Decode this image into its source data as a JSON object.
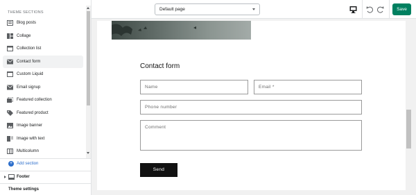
{
  "topbar": {
    "page_selector": "Default page",
    "save_label": "Save"
  },
  "sidebar": {
    "heading": "THEME SECTIONS",
    "items": [
      {
        "label": "Blog posts",
        "icon": "blog-icon"
      },
      {
        "label": "Collage",
        "icon": "collage-icon"
      },
      {
        "label": "Collection list",
        "icon": "collection-list-icon"
      },
      {
        "label": "Contact form",
        "icon": "envelope-icon",
        "active": true
      },
      {
        "label": "Custom Liquid",
        "icon": "code-icon"
      },
      {
        "label": "Email signup",
        "icon": "envelope-icon"
      },
      {
        "label": "Featured collection",
        "icon": "collection-icon"
      },
      {
        "label": "Featured product",
        "icon": "tag-icon"
      },
      {
        "label": "Image banner",
        "icon": "image-icon"
      },
      {
        "label": "Image with text",
        "icon": "image-text-icon"
      },
      {
        "label": "Multicolumn",
        "icon": "columns-icon"
      }
    ],
    "add_section": "Add section",
    "footer": "Footer",
    "theme_settings": "Theme settings"
  },
  "preview": {
    "form_title": "Contact form",
    "name_placeholder": "Name",
    "email_placeholder": "Email *",
    "phone_placeholder": "Phone number",
    "comment_placeholder": "Comment",
    "send_label": "Send"
  }
}
